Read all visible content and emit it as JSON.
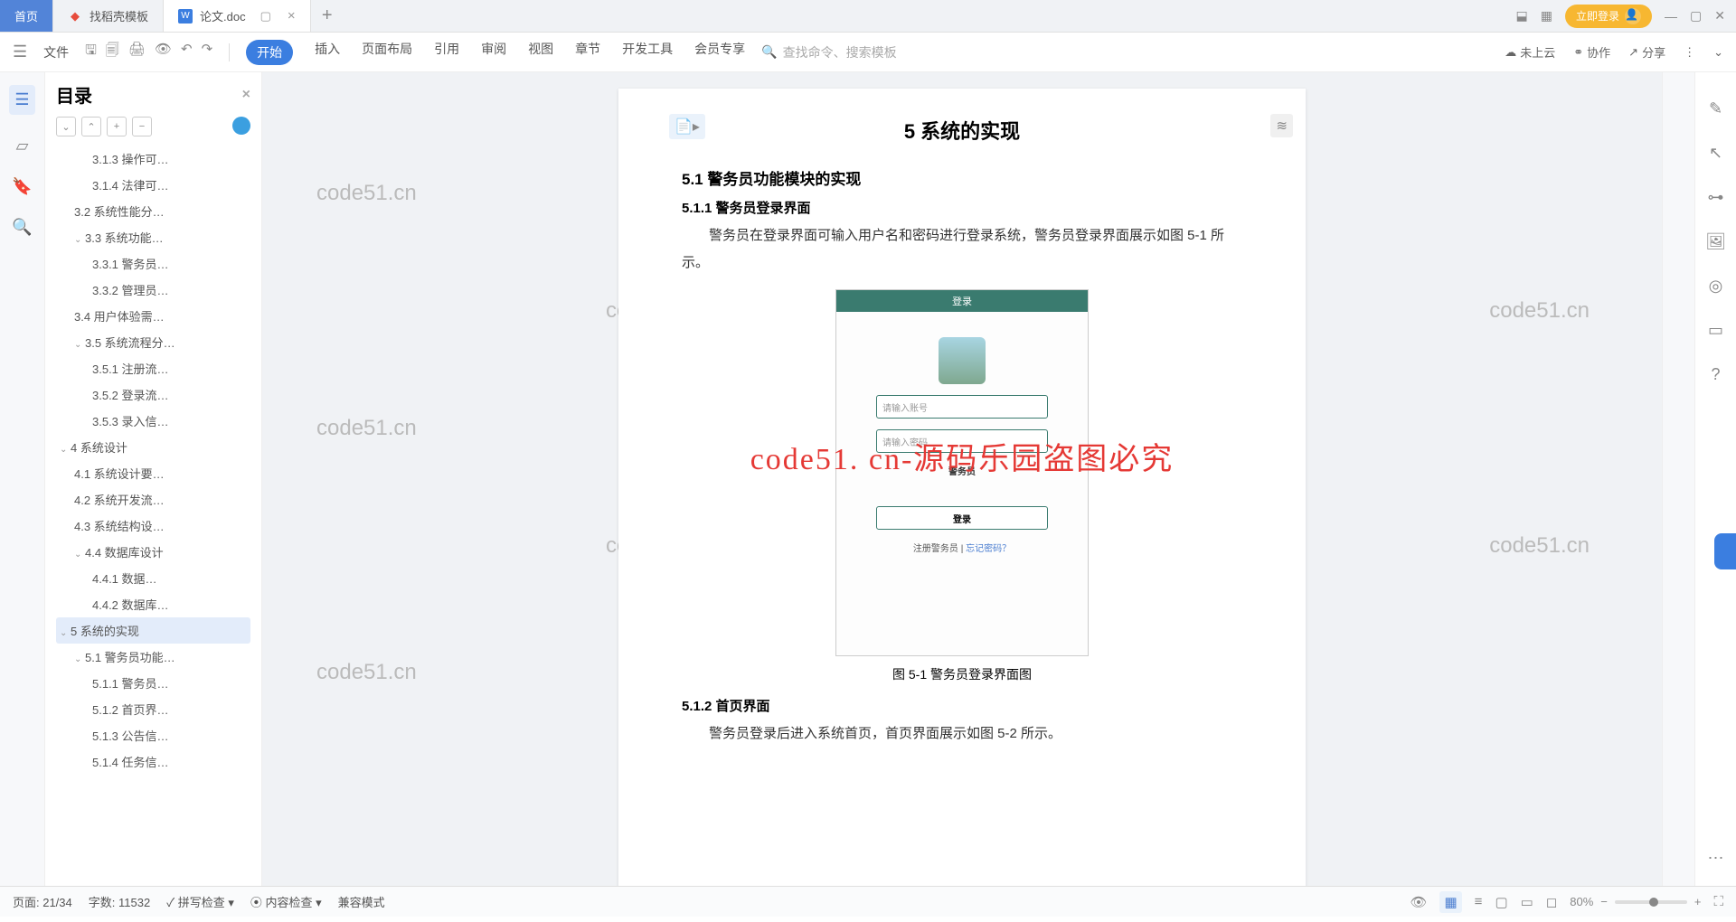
{
  "tabs": {
    "home": "首页",
    "templates": "找稻壳模板",
    "doc": "论文.doc"
  },
  "login_btn": "立即登录",
  "toolbar": {
    "file": "文件",
    "menus": [
      "开始",
      "插入",
      "页面布局",
      "引用",
      "审阅",
      "视图",
      "章节",
      "开发工具",
      "会员专享"
    ],
    "search_placeholder": "查找命令、搜索模板",
    "cloud": "未上云",
    "coop": "协作",
    "share": "分享"
  },
  "outline": {
    "title": "目录",
    "items": [
      {
        "lvl": 3,
        "text": "3.1.3 操作可…"
      },
      {
        "lvl": 3,
        "text": "3.1.4 法律可…"
      },
      {
        "lvl": 2,
        "text": "3.2 系统性能分…"
      },
      {
        "lvl": 2,
        "text": "3.3   系统功能…",
        "caret": "v"
      },
      {
        "lvl": 3,
        "text": "3.3.1 警务员…"
      },
      {
        "lvl": 3,
        "text": "3.3.2 管理员…"
      },
      {
        "lvl": 2,
        "text": "3.4 用户体验需…"
      },
      {
        "lvl": 2,
        "text": "3.5 系统流程分…",
        "caret": "v"
      },
      {
        "lvl": 3,
        "text": "3.5.1 注册流…"
      },
      {
        "lvl": 3,
        "text": "3.5.2 登录流…"
      },
      {
        "lvl": 3,
        "text": "3.5.3 录入信…"
      },
      {
        "lvl": 1,
        "text": "4 系统设计",
        "caret": "v"
      },
      {
        "lvl": 2,
        "text": "4.1 系统设计要…"
      },
      {
        "lvl": 2,
        "text": "4.2 系统开发流…"
      },
      {
        "lvl": 2,
        "text": "4.3 系统结构设…"
      },
      {
        "lvl": 2,
        "text": "4.4 数据库设计",
        "caret": "v"
      },
      {
        "lvl": 3,
        "text": "4.4.1 数据…"
      },
      {
        "lvl": 3,
        "text": "4.4.2 数据库…"
      },
      {
        "lvl": 1,
        "text": "5  系统的实现",
        "caret": "v",
        "active": true
      },
      {
        "lvl": 2,
        "text": "5.1 警务员功能…",
        "caret": "v"
      },
      {
        "lvl": 3,
        "text": "5.1.1 警务员…"
      },
      {
        "lvl": 3,
        "text": "5.1.2 首页界…"
      },
      {
        "lvl": 3,
        "text": "5.1.3 公告信…"
      },
      {
        "lvl": 3,
        "text": "5.1.4 任务信…"
      }
    ]
  },
  "doc": {
    "h1": "5  系统的实现",
    "h2_1": "5.1 警务员功能模块的实现",
    "h3_1": "5.1.1 警务员登录界面",
    "p1": "警务员在登录界面可输入用户名和密码进行登录系统，警务员登录界面展示如图 5-1 所示。",
    "fig_title": "登录",
    "fig_user_ph": "请输入账号",
    "fig_pwd_ph": "请输入密码",
    "fig_role": "警务员",
    "fig_login": "登录",
    "fig_reg": "注册警务员",
    "fig_forgot": "忘记密码？",
    "caption": "图 5-1   警务员登录界面图",
    "h3_2": "5.1.2 首页界面",
    "p2": "警务员登录后进入系统首页，首页界面展示如图 5-2 所示。"
  },
  "watermark": "code51.cn",
  "red_overlay": "code51. cn-源码乐园盗图必究",
  "status": {
    "page": "页面: 21/34",
    "words": "字数: 11532",
    "spell": "拼写检查",
    "content": "内容检查",
    "compat": "兼容模式",
    "zoom": "80%"
  }
}
